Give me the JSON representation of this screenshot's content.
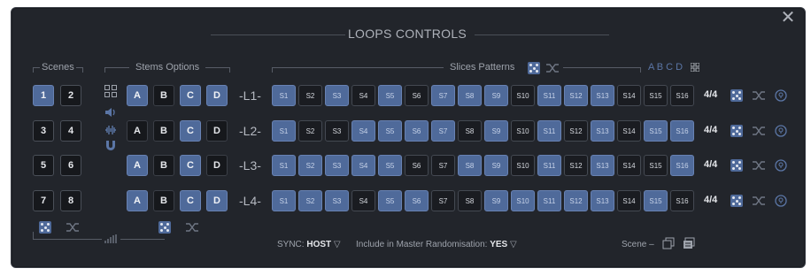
{
  "title": "LOOPS CONTROLS",
  "close_glyph": "✕",
  "sections": {
    "scenes": "Scenes",
    "stems": "Stems Options",
    "slices": "Slices Patterns",
    "abcd": "A B C D"
  },
  "scenes": [
    "1",
    "2",
    "3",
    "4",
    "5",
    "6",
    "7",
    "8"
  ],
  "scenes_selected": "1",
  "stem_letters": [
    "A",
    "B",
    "C",
    "D"
  ],
  "lanes": [
    {
      "label": "-L1-",
      "stems_on": [
        true,
        false,
        true,
        true
      ],
      "slices_on": [
        true,
        false,
        true,
        false,
        true,
        false,
        true,
        true,
        true,
        false,
        true,
        true,
        true,
        false,
        false,
        false
      ],
      "sig": "4/4"
    },
    {
      "label": "-L2-",
      "stems_on": [
        false,
        false,
        true,
        false
      ],
      "slices_on": [
        true,
        false,
        false,
        true,
        true,
        true,
        true,
        false,
        true,
        false,
        true,
        false,
        true,
        false,
        true,
        true
      ],
      "sig": "4/4"
    },
    {
      "label": "-L3-",
      "stems_on": [
        true,
        false,
        true,
        false
      ],
      "slices_on": [
        true,
        true,
        true,
        true,
        true,
        false,
        false,
        true,
        true,
        false,
        true,
        false,
        true,
        false,
        false,
        true
      ],
      "sig": "4/4"
    },
    {
      "label": "-L4-",
      "stems_on": [
        true,
        false,
        true,
        true
      ],
      "slices_on": [
        true,
        true,
        true,
        false,
        true,
        true,
        false,
        false,
        true,
        true,
        true,
        true,
        true,
        false,
        true,
        false
      ],
      "sig": "4/4"
    }
  ],
  "slice_labels": [
    "S1",
    "S2",
    "S3",
    "S4",
    "S5",
    "S6",
    "S7",
    "S8",
    "S9",
    "S10",
    "S11",
    "S12",
    "S13",
    "S14",
    "S15",
    "S16"
  ],
  "footer": {
    "sync_label": "SYNC:",
    "sync_value": "HOST",
    "randomise_label": "Include in Master Randomisation:",
    "randomise_value": "YES",
    "scene_label": "Scene –",
    "dropdown_glyph": "▽"
  },
  "icons": [
    "close-icon",
    "grid-icon",
    "speaker-icon",
    "waveform-icon",
    "magnet-icon",
    "dice-icon",
    "shuffle-icon",
    "info-icon",
    "copy-icon",
    "paste-icon",
    "chart-icon"
  ],
  "colors": {
    "panel": "#22252b",
    "accent": "#4f6a9a",
    "button_dark": "#16181c"
  }
}
